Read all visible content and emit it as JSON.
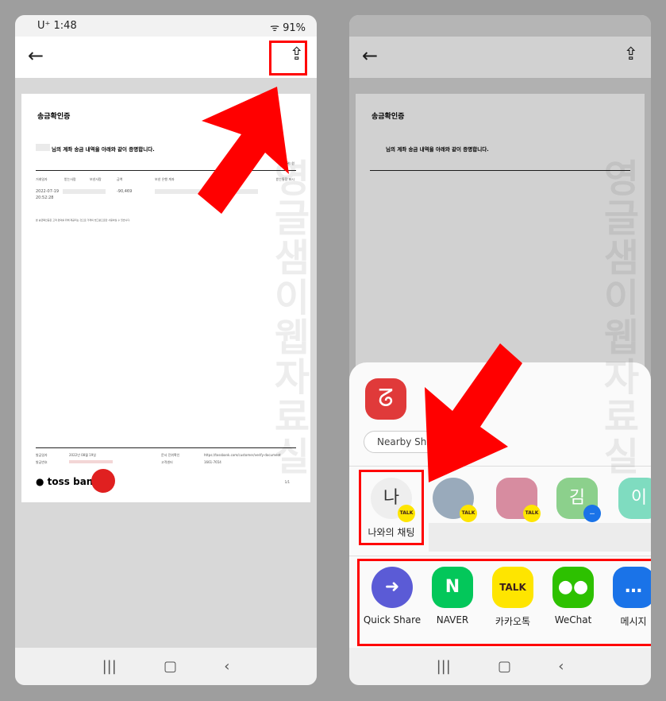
{
  "status": {
    "carrier": "U⁺",
    "time": "1:48",
    "battery": "91%"
  },
  "document": {
    "title": "송금확인증",
    "subtitle": "님의 계좌 송금 내역을 아래와 같이 증명합니다.",
    "unit": "단위: 원",
    "headers": [
      "거래일자",
      "받는사람",
      "보낸사람",
      "금액",
      "보낸 은행 계좌",
      "받는통장 표시"
    ],
    "row": {
      "date": "2022-07-19",
      "time": "20:52:28",
      "amount": "-90,469"
    },
    "note": "본 송금확인증은 고객 편의를 위해 제공되는 것으로 거래의 법그활으로만 사용하실 수 있습니다.",
    "footer": {
      "issue_date_label": "발급일자",
      "issue_date": "2022년 08월 19일",
      "issue_no_label": "발급번호",
      "verify_label": "문서 진위확인",
      "verify_url": "https://tossbank.com/customer/verify-document",
      "cs_label": "고객센터",
      "cs_phone": "1661-7654",
      "brand": "toss bank",
      "page": "1/1"
    }
  },
  "watermark": "영글샘이웹자료실",
  "share_sheet": {
    "nearby_share": "Nearby Share",
    "self_chat": {
      "avatar": "나",
      "label": "나와의 채팅"
    },
    "contacts": [
      {
        "avatar": "김"
      },
      {
        "avatar": "이"
      }
    ],
    "badge_talk": "TALK",
    "apps": [
      {
        "label": "Quick Share",
        "color": "#5b5bd6"
      },
      {
        "label": "NAVER",
        "color": "#03c75a"
      },
      {
        "label": "카카오톡",
        "color": "#fee500"
      },
      {
        "label": "WeChat",
        "color": "#2dc100"
      },
      {
        "label": "메시지",
        "color": "#1a73e8"
      }
    ]
  },
  "annotation_color": "#ff0000"
}
